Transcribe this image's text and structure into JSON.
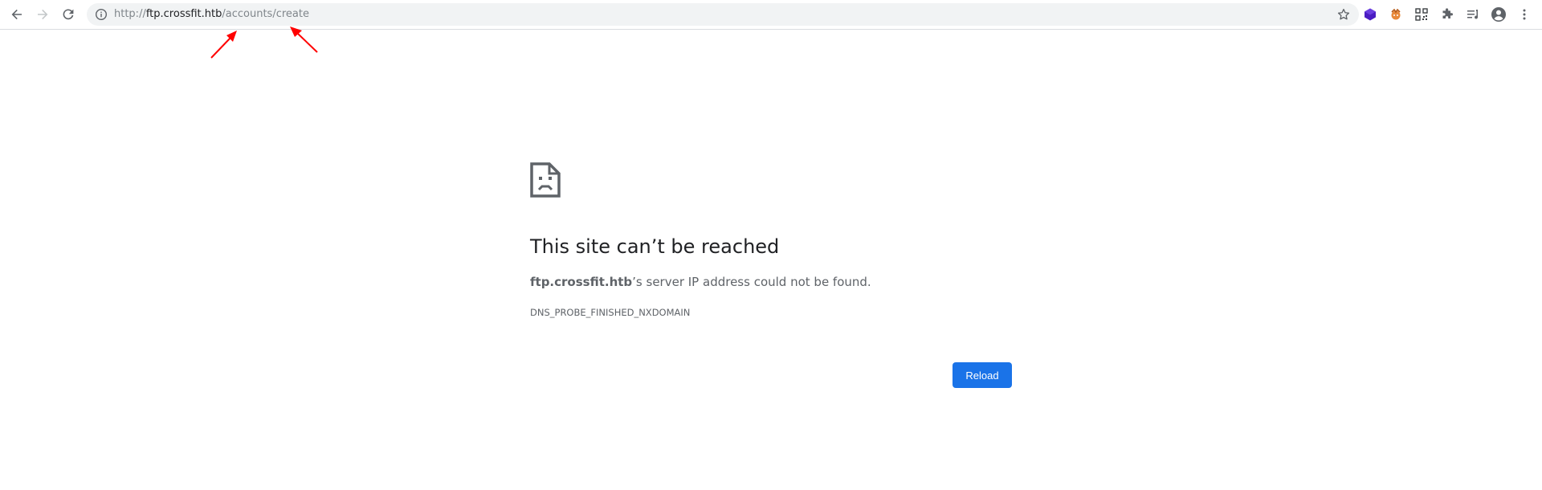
{
  "toolbar": {
    "url_scheme": "http://",
    "url_host": "ftp.crossfit.htb",
    "url_path": "/accounts/create",
    "icons": {
      "back": "arrow-left-icon",
      "forward": "arrow-right-icon",
      "reload": "reload-icon",
      "site_info": "info-icon",
      "bookmark": "star-icon",
      "extensions": [
        "purple-cube-extension-icon",
        "orange-extension-icon",
        "qr-code-extension-icon",
        "puzzle-extensions-icon",
        "reading-list-icon",
        "profile-avatar-icon",
        "menu-kebab-icon"
      ]
    }
  },
  "annotations": {
    "arrow_color": "#ff0000"
  },
  "error_page": {
    "icon": "sad-document-icon",
    "title": "This site can’t be reached",
    "host": "ftp.crossfit.htb",
    "message_suffix": "’s server IP address could not be found.",
    "error_code": "DNS_PROBE_FINISHED_NXDOMAIN",
    "reload_label": "Reload",
    "button_color": "#1a73e8"
  }
}
